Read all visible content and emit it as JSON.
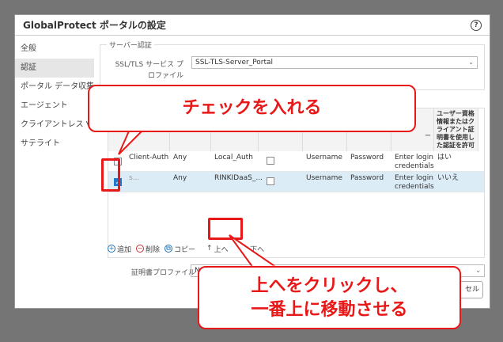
{
  "dialog": {
    "title": "GlobalProtect ポータルの設定",
    "help_icon": "?"
  },
  "sidebar": {
    "items": [
      {
        "label": "全般"
      },
      {
        "label": "認証",
        "active": true
      },
      {
        "label": "ポータル データ収集"
      },
      {
        "label": "エージェント"
      },
      {
        "label": "クライアントレス V"
      },
      {
        "label": "サテライト"
      }
    ]
  },
  "server_auth": {
    "legend": "サーバー認証",
    "profile_label": "SSL/TLS サービス プロファイル",
    "profile_value": "SSL-TLS-Server_Portal"
  },
  "table": {
    "header_last": "ユーザー資格情報またはクライアント証明書を使用した認証を許可",
    "header_msg_suffix": "ー",
    "rows": [
      {
        "name": "Client-Auth",
        "os": "Any",
        "profile": "Local_Auth",
        "user_label": "Username",
        "pass_label": "Password",
        "message": "Enter login credentials",
        "allow": "はい",
        "checked": false
      },
      {
        "name": "s...",
        "os": "Any",
        "profile": "RINKIDaaS_...",
        "user_label": "Username",
        "pass_label": "Password",
        "message": "Enter login credentials",
        "allow": "いいえ",
        "checked": true
      }
    ]
  },
  "toolbar": {
    "add": "追加",
    "delete": "削除",
    "copy": "コピー",
    "up": "上へ",
    "down": "下へ"
  },
  "cert_profile": {
    "label": "証明書プロファイル",
    "value": "None"
  },
  "cancel_label": "セル",
  "callouts": {
    "check": "チェックを入れる",
    "move_line1": "上へをクリックし、",
    "move_line2": "一番上に移動させる"
  },
  "colors": {
    "highlight": "#e81818",
    "selected_row": "#dcecf7",
    "checkbox": "#1f78c8"
  }
}
